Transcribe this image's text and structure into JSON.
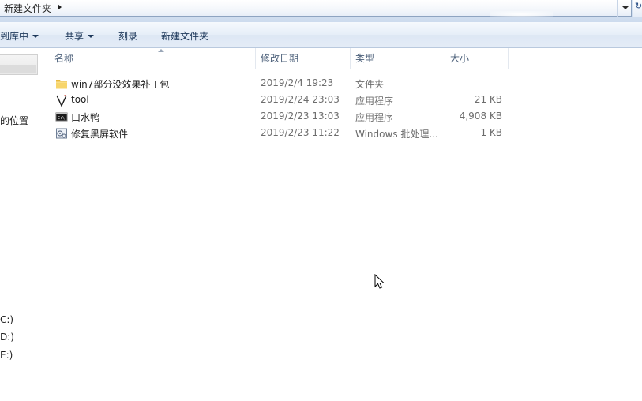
{
  "address_bar": {
    "breadcrumb": "新建文件夹"
  },
  "toolbar": {
    "library": "到库中",
    "share": "共享",
    "burn": "刻录",
    "new_folder": "新建文件夹"
  },
  "nav_pane": {
    "items": [
      "的位置",
      "C:)",
      "D:)",
      "E:)"
    ]
  },
  "columns": {
    "name": "名称",
    "date": "修改日期",
    "type": "类型",
    "size": "大小"
  },
  "files": [
    {
      "icon": "folder-icon",
      "name": "win7部分没效果补丁包",
      "date": "2019/2/4 19:23",
      "type": "文件夹",
      "size": ""
    },
    {
      "icon": "vim-tool-icon",
      "name": "tool",
      "date": "2019/2/24 23:03",
      "type": "应用程序",
      "size": "21 KB"
    },
    {
      "icon": "console-app-icon",
      "name": "口水鸭",
      "date": "2019/2/23 13:03",
      "type": "应用程序",
      "size": "4,908 KB"
    },
    {
      "icon": "batch-file-icon",
      "name": "修复黑屏软件",
      "date": "2019/2/23 11:22",
      "type": "Windows 批处理...",
      "size": "1 KB"
    }
  ],
  "colors": {
    "toolbar_text": "#1e395b",
    "header_text": "#4c607a",
    "secondary_text": "#6d6d6d"
  }
}
